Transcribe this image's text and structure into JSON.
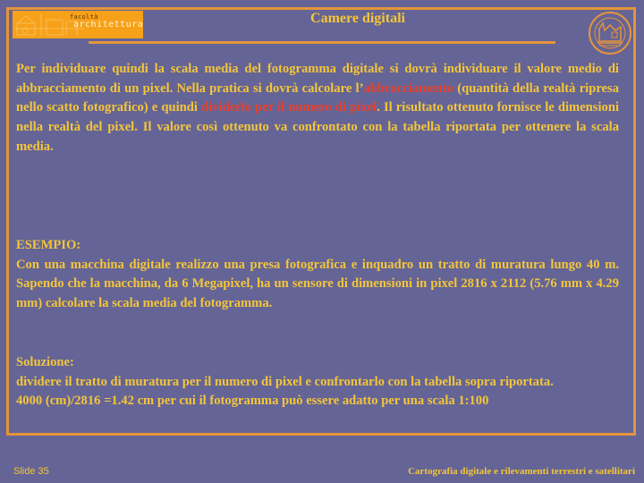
{
  "header": {
    "logo": {
      "line1": "facoltà",
      "line2": "architettura"
    },
    "title": "Camere digitali",
    "seal_icon": "university-seal-icon"
  },
  "body": {
    "paragraph1": {
      "before_highlight1": "Per individuare quindi la scala media del fotogramma digitale si dovrà individuare il valore medio di abbracciamento di un pixel. Nella pratica si dovrà calcolare l’",
      "highlight1": "abbracciamento",
      "between": " (quantità della realtà ripresa nello scatto fotografico) e quindi ",
      "highlight2": "dividerlo per il numero di pixel",
      "after": ". Il risultato ottenuto fornisce le dimensioni nella realtà del pixel. Il valore così ottenuto va confrontato con la tabella riportata per ottenere la scala media."
    },
    "example": {
      "heading": "ESEMPIO:",
      "text": "Con una macchina digitale realizzo una presa fotografica e inquadro un tratto di muratura lungo 40 m. Sapendo che la macchina, da 6 Megapixel, ha un sensore di dimensioni in pixel 2816 x 2112 (5.76 mm x 4.29 mm) calcolare la scala media del fotogramma."
    },
    "solution": {
      "heading": "Soluzione:",
      "line1": "dividere il tratto di muratura per il numero di pixel e confrontarlo con la tabella sopra riportata.",
      "line2": "4000 (cm)/2816 =1.42 cm per cui il fotogramma può essere adatto per una scala 1:100"
    }
  },
  "footer": {
    "slide_label": "Slide 35",
    "course": "Cartografia digitale e rilevamenti terrestri e satellitari"
  },
  "colors": {
    "background": "#656496",
    "accent_orange": "#e5943a",
    "text_yellow": "#f3c63a",
    "highlight_red": "#e8412c"
  }
}
